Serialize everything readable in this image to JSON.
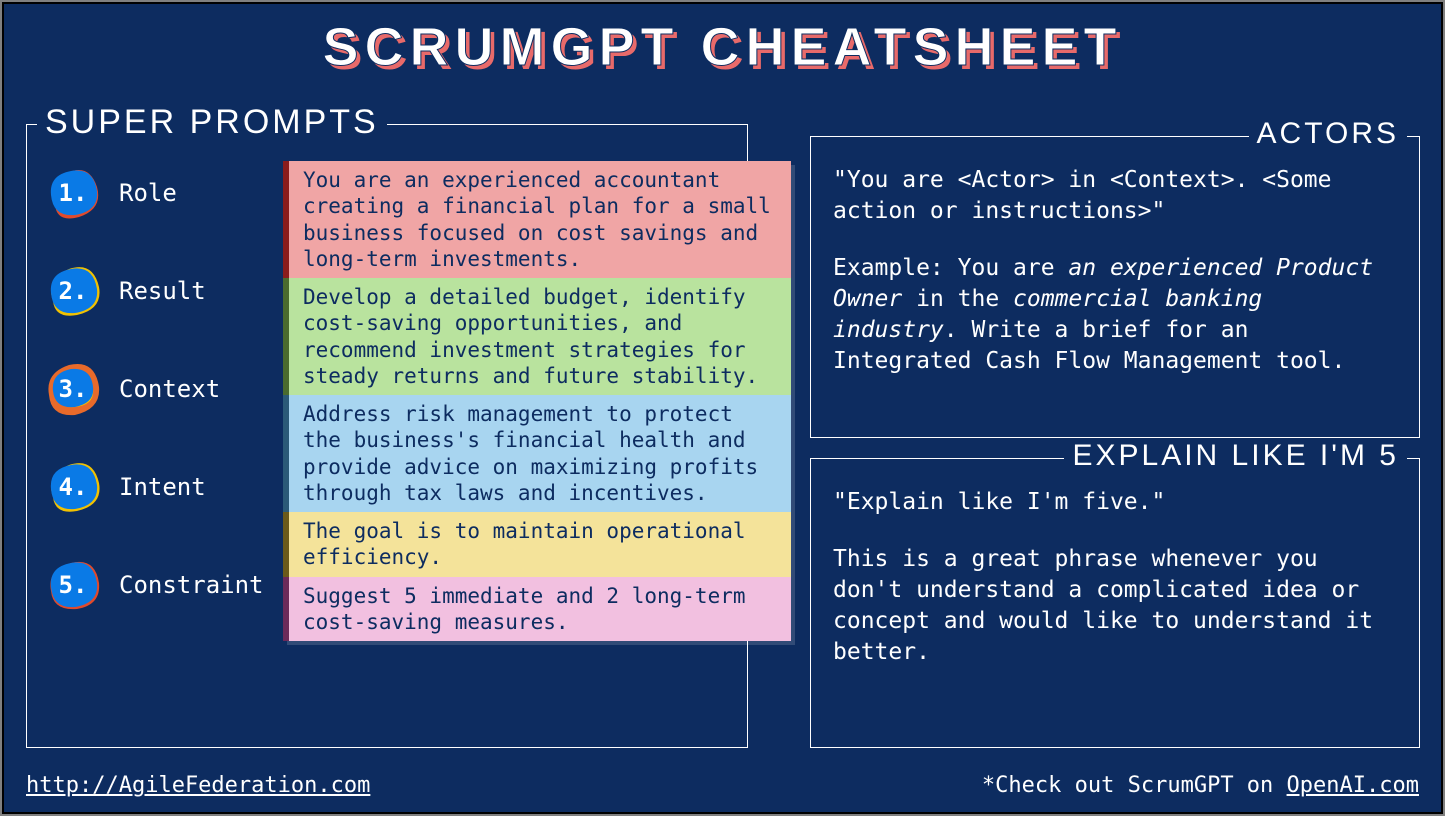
{
  "title": "SCRUMGPT CHEATSHEET",
  "panels": {
    "super": {
      "label": "SUPER PROMPTS"
    },
    "actors": {
      "label": "ACTORS"
    },
    "eli5": {
      "label": "EXPLAIN LIKE I'M 5"
    }
  },
  "prompts": [
    {
      "num": "1.",
      "name": "Role"
    },
    {
      "num": "2.",
      "name": "Result"
    },
    {
      "num": "3.",
      "name": "Context"
    },
    {
      "num": "4.",
      "name": "Intent"
    },
    {
      "num": "5.",
      "name": "Constraint"
    }
  ],
  "examples": {
    "role": "You are an experienced accountant creating a financial plan for a small business focused on cost savings and long-term investments.",
    "result": "Develop a detailed budget, identify cost-saving opportunities, and recommend investment strategies for steady returns and future stability.",
    "context": "Address risk management to protect the business's financial health and provide advice on maximizing profits through tax laws and incentives.",
    "intent": "The goal is to maintain operational efficiency.",
    "constraint": "Suggest 5 immediate and 2 long-term cost-saving measures."
  },
  "actors": {
    "template_open": "\"You are <Actor> in <Context>. <Some action or instructions>\"",
    "example_prefix": "Example: You are ",
    "example_actor": "an experienced Product Owner",
    "example_mid": " in the ",
    "example_context": "commercial banking industry",
    "example_end": ". Write a brief for an Integrated Cash Flow Management tool."
  },
  "eli5": {
    "quote": "\"Explain like I'm five.\"",
    "body": "This is a great phrase whenever you don't understand a complicated idea or concept and would like to understand it better."
  },
  "footer": {
    "left": "http://AgileFederation.com",
    "right_prefix": "*Check out ScrumGPT on ",
    "right_link": "OpenAI.com"
  }
}
